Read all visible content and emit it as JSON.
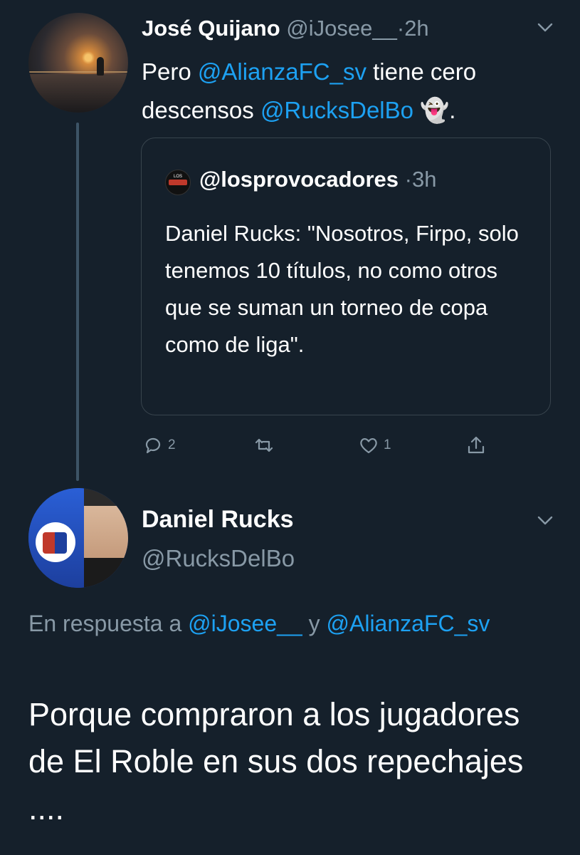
{
  "tweet1": {
    "name": "José Quijano",
    "handle": "@iJosee__",
    "sep": "·",
    "time": "2h",
    "text_before": "Pero ",
    "mention1": "@AlianzaFC_sv",
    "text_mid": " tiene cero descensos ",
    "mention2": "@RucksDelBo",
    "emoji": " 👻",
    "text_end": "."
  },
  "quoted": {
    "handle": "@losprovocadores",
    "sep": "·",
    "time": "3h",
    "avatar_text": "LOS",
    "text": "Daniel Rucks: \"Nosotros, Firpo, solo tenemos 10 títulos, no como otros que se suman un torneo de copa como de liga\"."
  },
  "actions": {
    "reply_count": "2",
    "like_count": "1"
  },
  "tweet2": {
    "name": "Daniel Rucks",
    "handle": "@RucksDelBo",
    "reply_prefix": "En respuesta a ",
    "reply_mention1": "@iJosee__",
    "reply_and": " y ",
    "reply_mention2": "@AlianzaFC_sv",
    "text": "Porque compraron a los jugadores de El Roble en sus dos repechajes ...."
  },
  "colors": {
    "background": "#15202b",
    "link": "#1da1f2",
    "muted": "#8899a6"
  }
}
